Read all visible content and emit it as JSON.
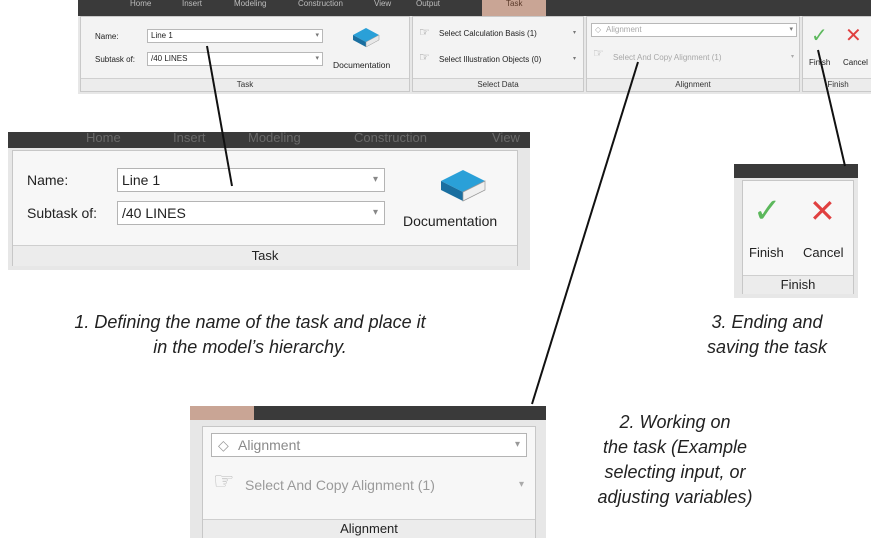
{
  "top_ribbon": {
    "tabs": [
      "Home",
      "Insert",
      "Modeling",
      "Construction",
      "View",
      "Output",
      "Task"
    ],
    "task_group": {
      "name_label": "Name:",
      "name_value": "Line 1",
      "subtask_label": "Subtask of:",
      "subtask_value": "/40 LINES",
      "documentation_label": "Documentation",
      "group_label": "Task"
    },
    "select_group": {
      "calc_basis": "Select Calculation Basis (1)",
      "illustration": "Select Illustration Objects (0)",
      "group_label": "Select Data"
    },
    "alignment_group": {
      "alignment_value": "Alignment",
      "select_copy": "Select And Copy Alignment (1)",
      "group_label": "Alignment"
    },
    "finish_group": {
      "finish": "Finish",
      "cancel": "Cancel",
      "group_label": "Finish"
    }
  },
  "zoom_task": {
    "tabs": [
      "Home",
      "Insert",
      "Modeling",
      "Construction",
      "View"
    ],
    "name_label": "Name:",
    "name_value": "Line 1",
    "subtask_label": "Subtask of:",
    "subtask_value": "/40 LINES",
    "documentation_label": "Documentation",
    "group_label": "Task"
  },
  "zoom_finish": {
    "finish": "Finish",
    "cancel": "Cancel",
    "group_label": "Finish"
  },
  "zoom_alignment": {
    "alignment_value": "Alignment",
    "select_copy": "Select And Copy Alignment (1)",
    "group_label": "Alignment"
  },
  "captions": {
    "step1_line1": "1. Defining the name of the task and place it",
    "step1_line2": "in the model’s hierarchy.",
    "step2_line1": "2. Working on",
    "step2_line2": "the task (Example",
    "step2_line3": "selecting input, or",
    "step2_line4": "adjusting variables)",
    "step3_line1": "3.  Ending and",
    "step3_line2": "saving the task"
  },
  "colors": {
    "ribbon_dark": "#3a3a3a",
    "active_tab": "#c9a595",
    "finish_check": "#5cb85c",
    "cancel_x": "#e04040"
  }
}
